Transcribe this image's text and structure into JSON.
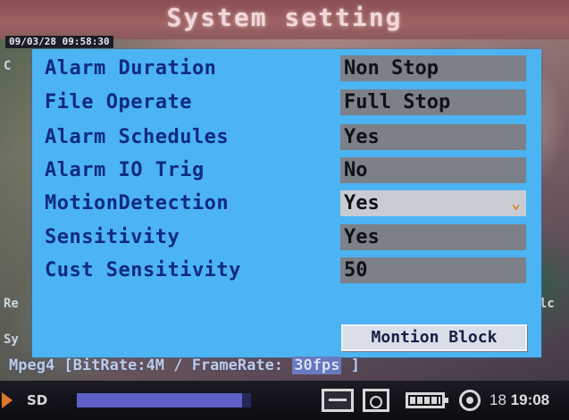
{
  "title": "System setting",
  "overlay_timestamp": "09/03/28 09:58:30",
  "edge_glyphs": [
    "C",
    "Re",
    "Sy",
    "lc"
  ],
  "settings": [
    {
      "label": "Alarm Duration",
      "value": "Non Stop"
    },
    {
      "label": "File Operate",
      "value": "Full Stop"
    },
    {
      "label": "Alarm Schedules",
      "value": "Yes"
    },
    {
      "label": "Alarm IO Trig",
      "value": "No"
    },
    {
      "label": "MotionDetection",
      "value": "Yes",
      "focused": true
    },
    {
      "label": "Sensitivity",
      "value": "Yes"
    },
    {
      "label": "Cust Sensitivity",
      "value": "50"
    }
  ],
  "motion_block_button": "Montion Block",
  "status_line": {
    "prefix": "Mpeg4 [BitRate:4M / FrameRate:",
    "fps_value": "30fps",
    "suffix": "]"
  },
  "bottom_bar": {
    "rec_label": "SD",
    "progress": 0.95,
    "day": "18",
    "time": "19:08",
    "icons": [
      "play-arrow-icon",
      "keyboard-icon",
      "sd-card-icon",
      "battery-icon",
      "record-icon"
    ]
  },
  "colors": {
    "panel": "#4cb4f2",
    "label_text": "#0f2a83",
    "value_field": "#7c8189",
    "title_bar": "#9e6262"
  }
}
